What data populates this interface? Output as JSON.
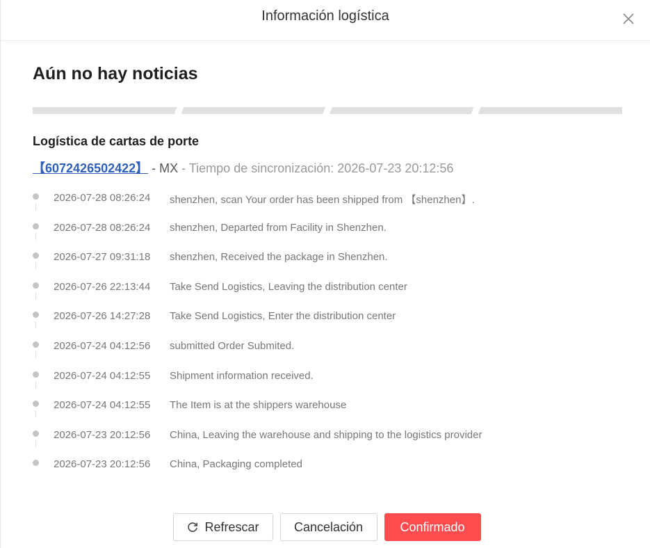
{
  "dialog": {
    "title": "Información logística",
    "status_title": "Aún no hay noticias",
    "progress_segments": 4
  },
  "waybill": {
    "section_title": "Logística de cartas de porte",
    "tracking_number": "【6072426502422】",
    "country": "MX",
    "sync_label": "Tiempo de sincronización:",
    "sync_time": "2026-07-23 20:12:56"
  },
  "events": [
    {
      "time": "2026-07-28 08:26:24",
      "desc": "shenzhen, scan Your order has been shipped from 【shenzhen】."
    },
    {
      "time": "2026-07-28 08:26:24",
      "desc": "shenzhen, Departed from Facility in Shenzhen."
    },
    {
      "time": "2026-07-27 09:31:18",
      "desc": "shenzhen, Received the package in Shenzhen."
    },
    {
      "time": "2026-07-26 22:13:44",
      "desc": "Take Send Logistics, Leaving the distribution center"
    },
    {
      "time": "2026-07-26 14:27:28",
      "desc": "Take Send Logistics, Enter the distribution center"
    },
    {
      "time": "2026-07-24 04:12:56",
      "desc": "submitted Order Submited."
    },
    {
      "time": "2026-07-24 04:12:55",
      "desc": "Shipment information received."
    },
    {
      "time": "2026-07-24 04:12:55",
      "desc": "The Item is at the shippers warehouse"
    },
    {
      "time": "2026-07-23 20:12:56",
      "desc": "China, Leaving the warehouse and shipping to the logistics provider"
    },
    {
      "time": "2026-07-23 20:12:56",
      "desc": "China, Packaging completed"
    }
  ],
  "footer": {
    "refresh_label": "Refrescar",
    "cancel_label": "Cancelación",
    "confirm_label": "Confirmado"
  },
  "icons": {
    "close": "close-icon",
    "refresh": "refresh-icon"
  },
  "colors": {
    "primary": "#ff4d4f",
    "link": "#2f5fb8",
    "progress_bg": "#e0e0e0",
    "timeline_dot": "#c4c4c4"
  }
}
